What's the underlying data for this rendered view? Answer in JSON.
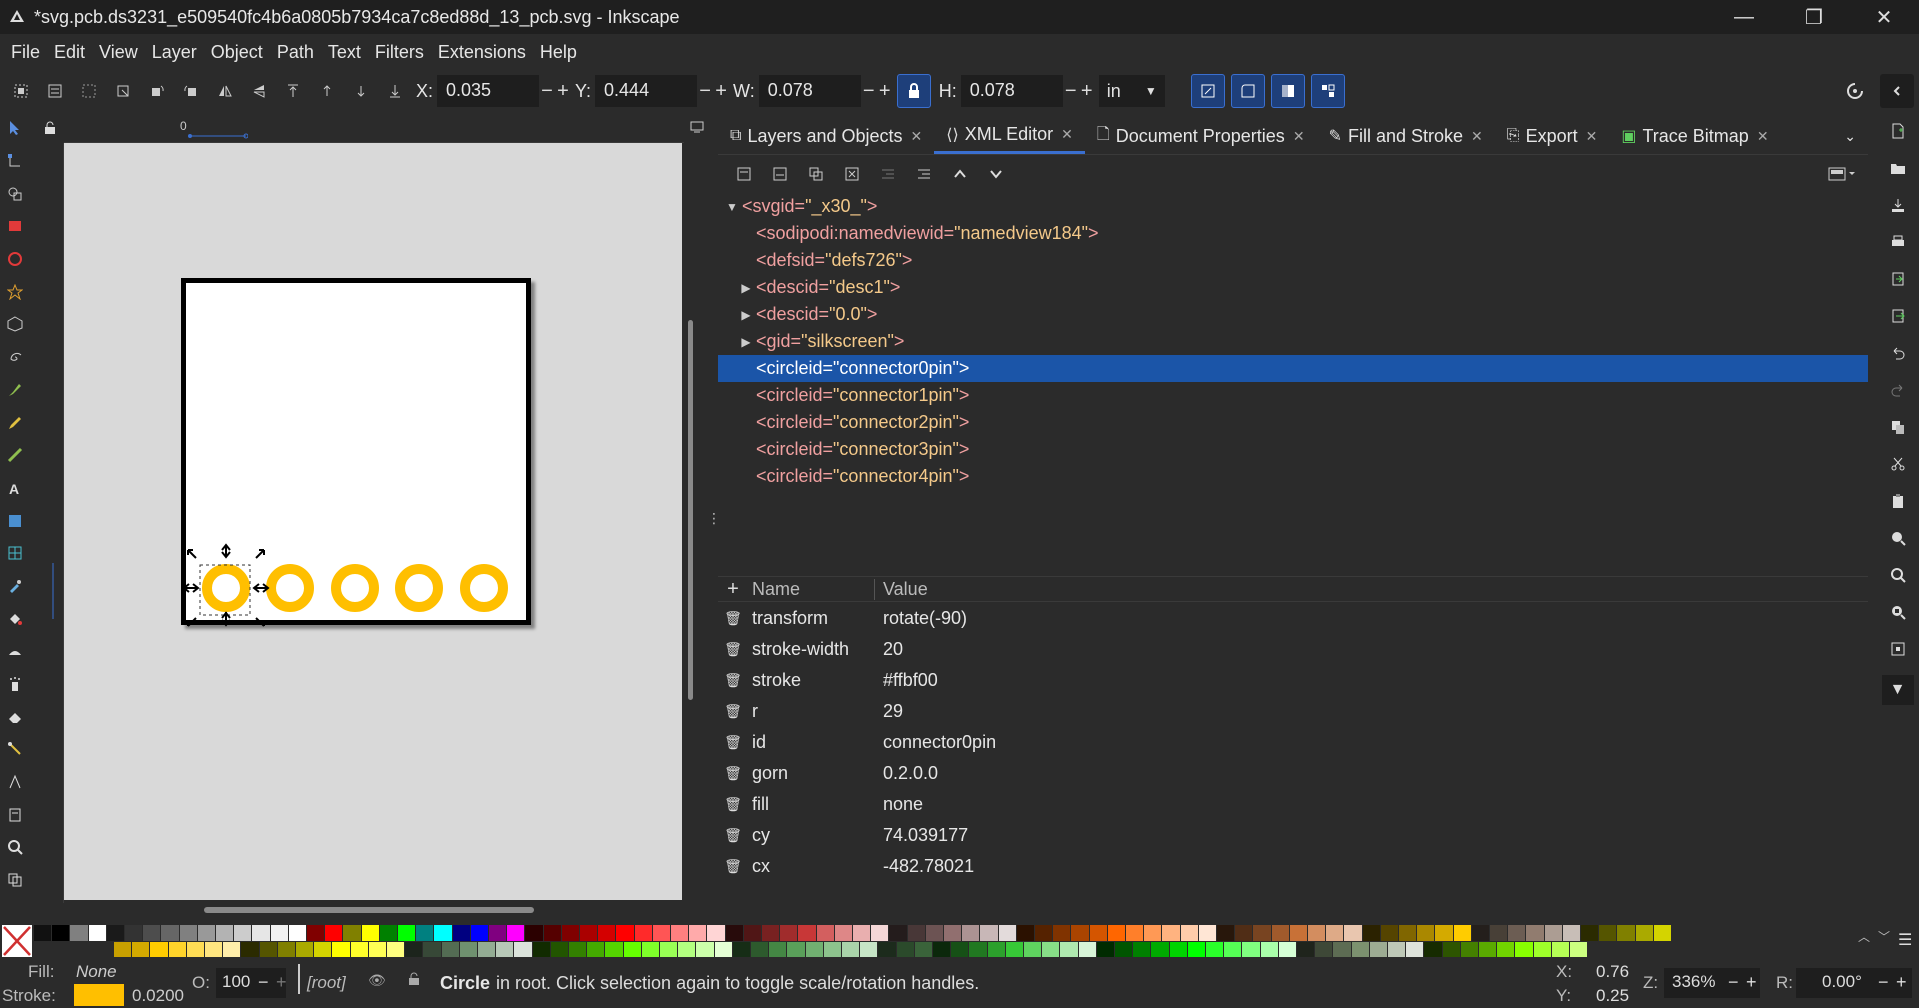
{
  "window": {
    "title": "*svg.pcb.ds3231_e509540fc4b6a0805b7934ca7c8ed88d_13_pcb.svg - Inkscape",
    "minimize": "—",
    "maximize": "❐",
    "close": "✕"
  },
  "menu": [
    "File",
    "Edit",
    "View",
    "Layer",
    "Object",
    "Path",
    "Text",
    "Filters",
    "Extensions",
    "Help"
  ],
  "toolbar": {
    "x_label": "X:",
    "x_value": "0.035",
    "y_label": "Y:",
    "y_value": "0.444",
    "w_label": "W:",
    "w_value": "0.078",
    "h_label": "H:",
    "h_value": "0.078",
    "minus": "−",
    "plus": "+",
    "unit": "in"
  },
  "ruler": {
    "zero": "0"
  },
  "tabs": [
    {
      "label": "Layers and Objects",
      "icon": "layers-icon"
    },
    {
      "label": "XML Editor",
      "icon": "xml-icon",
      "active": true
    },
    {
      "label": "Document Properties",
      "icon": "document-icon"
    },
    {
      "label": "Fill and Stroke",
      "icon": "fill-stroke-icon"
    },
    {
      "label": "Export",
      "icon": "export-icon"
    },
    {
      "label": "Trace Bitmap",
      "icon": "trace-icon"
    }
  ],
  "xml_tree": [
    {
      "indent": 0,
      "arrow": "▼",
      "tag": "<svg",
      "attr": " id=",
      "value": "\"_x30_\"",
      "close": ">"
    },
    {
      "indent": 1,
      "arrow": "",
      "tag": "<sodipodi:namedview",
      "attr": " id=",
      "value": "\"namedview184\"",
      "close": ">"
    },
    {
      "indent": 1,
      "arrow": "",
      "tag": "<defs",
      "attr": " id=",
      "value": "\"defs726\"",
      "close": ">"
    },
    {
      "indent": 1,
      "arrow": "▶",
      "tag": "<desc",
      "attr": " id=",
      "value": "\"desc1\"",
      "close": ">"
    },
    {
      "indent": 1,
      "arrow": "▶",
      "tag": "<desc",
      "attr": " id=",
      "value": "\"0.0\"",
      "close": ">"
    },
    {
      "indent": 1,
      "arrow": "▶",
      "tag": "<g",
      "attr": " id=",
      "value": "\"silkscreen\"",
      "close": ">"
    },
    {
      "indent": 1,
      "arrow": "",
      "tag": "<circle",
      "attr": " id=",
      "value": "\"connector0pin\"",
      "close": ">",
      "selected": true
    },
    {
      "indent": 1,
      "arrow": "",
      "tag": "<circle",
      "attr": " id=",
      "value": "\"connector1pin\"",
      "close": ">"
    },
    {
      "indent": 1,
      "arrow": "",
      "tag": "<circle",
      "attr": " id=",
      "value": "\"connector2pin\"",
      "close": ">"
    },
    {
      "indent": 1,
      "arrow": "",
      "tag": "<circle",
      "attr": " id=",
      "value": "\"connector3pin\"",
      "close": ">"
    },
    {
      "indent": 1,
      "arrow": "",
      "tag": "<circle",
      "attr": " id=",
      "value": "\"connector4pin\"",
      "close": ">"
    }
  ],
  "attributes": {
    "header_name": "Name",
    "header_value": "Value",
    "add": "+",
    "rows": [
      {
        "name": "transform",
        "value": "rotate(-90)"
      },
      {
        "name": "stroke-width",
        "value": "20"
      },
      {
        "name": "stroke",
        "value": "#ffbf00"
      },
      {
        "name": "r",
        "value": "29"
      },
      {
        "name": "id",
        "value": "connector0pin"
      },
      {
        "name": "gorn",
        "value": "0.2.0.0"
      },
      {
        "name": "fill",
        "value": "none"
      },
      {
        "name": "cy",
        "value": "74.039177"
      },
      {
        "name": "cx",
        "value": "-482.78021"
      }
    ]
  },
  "colors": {
    "pin": "#ffbf00",
    "selection": "#1b55a8",
    "accent": "#3a6fd0"
  },
  "status": {
    "fill_label": "Fill:",
    "fill_value": "None",
    "stroke_label": "Stroke:",
    "stroke_width": "0.0200",
    "opacity_label": "O:",
    "opacity_value": "100",
    "layer": "[root]",
    "object_type": "Circle",
    "message": "in root. Click selection again to toggle scale/rotation handles.",
    "cx_label": "X:",
    "cx_value": "0.76",
    "cy_label": "Y:",
    "cy_value": "0.25",
    "zoom_label": "Z:",
    "zoom_value": "336%",
    "rot_label": "R:",
    "rot_value": "0.00°"
  }
}
